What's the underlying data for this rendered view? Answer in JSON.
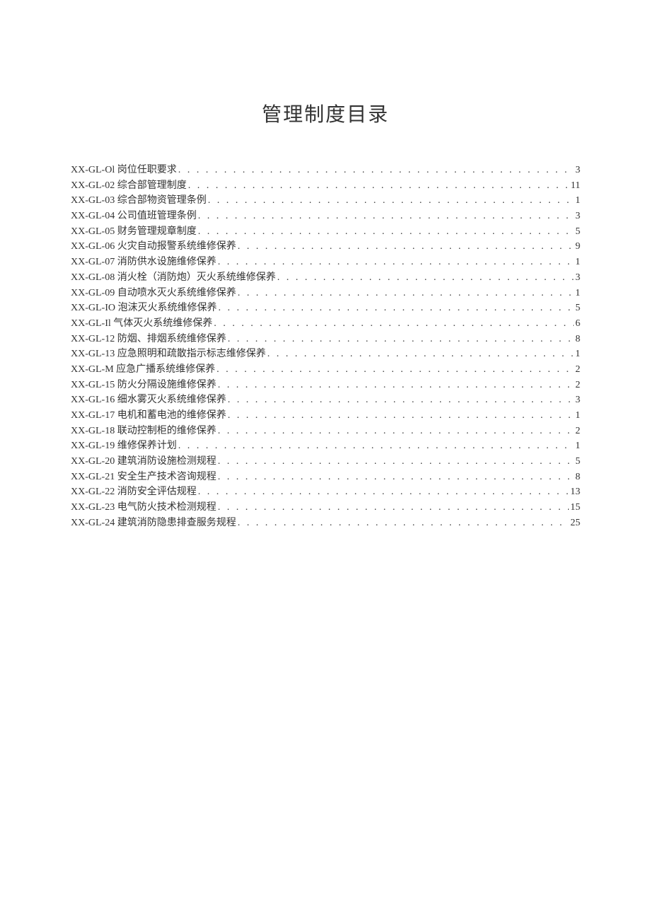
{
  "title": "管理制度目录",
  "toc": [
    {
      "label": "XX-GL-Ol 岗位任职要求",
      "page": "3"
    },
    {
      "label": "XX-GL-02 综合部管理制度",
      "page": "11"
    },
    {
      "label": "XX-GL-03 综合部物资管理条例",
      "page": "1"
    },
    {
      "label": "XX-GL-04 公司值班管理条例",
      "page": "3"
    },
    {
      "label": "XX-GL-05 财务管理规章制度",
      "page": "5"
    },
    {
      "label": "XX-GL-06 火灾自动报警系统维修保养",
      "page": "9"
    },
    {
      "label": "XX-GL-07 消防供水设施维修保养",
      "page": "1"
    },
    {
      "label": "XX-GL-08 消火栓（消防炮）灭火系统维修保养",
      "page": "3"
    },
    {
      "label": "XX-GL-09 自动喷水灭火系统维修保养",
      "page": "1"
    },
    {
      "label": "XX-GL-IO 泡沫灭火系统维修保养",
      "page": "5"
    },
    {
      "label": "XX-GL-Il 气体灭火系统维修保养",
      "page": "6"
    },
    {
      "label": "XX-GL-12 防烟、排烟系统维修保养",
      "page": "8"
    },
    {
      "label": "XX-GL-13 应急照明和疏散指示标志维修保养",
      "page": "1"
    },
    {
      "label": "XX-GL-M 应急广播系统维修保养",
      "page": "2"
    },
    {
      "label": "XX-GL-15 防火分隔设施维修保养",
      "page": "2"
    },
    {
      "label": "XX-GL-16 细水雾灭火系统维修保养",
      "page": "3"
    },
    {
      "label": "XX-GL-17 电机和蓄电池的维修保养",
      "page": "1"
    },
    {
      "label": "XX-GL-18 联动控制柜的维修保养",
      "page": "2"
    },
    {
      "label": "XX-GL-19 维修保养计划",
      "page": "1"
    },
    {
      "label": "XX-GL-20 建筑消防设施检测规程",
      "page": "5"
    },
    {
      "label": "XX-GL-21 安全生产技术咨询规程",
      "page": "8"
    },
    {
      "label": "XX-GL-22 消防安全评估规程",
      "page": "13"
    },
    {
      "label": "XX-GL-23 电气防火技术检测规程",
      "page": "15"
    },
    {
      "label": "XX-GL-24 建筑消防隐患排查服务规程",
      "page": "25"
    }
  ]
}
